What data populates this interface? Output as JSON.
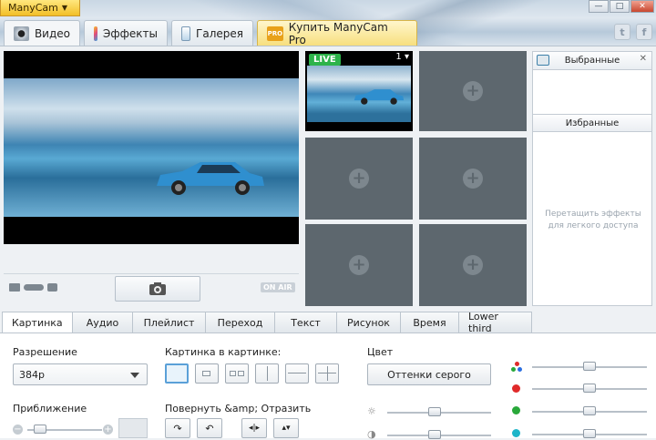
{
  "app": {
    "menu_label": "ManyCam"
  },
  "window": {
    "minimize": "—",
    "maximize": "□",
    "close": "✕"
  },
  "main_tabs": [
    {
      "label": "Видео",
      "icon": "webcam-icon"
    },
    {
      "label": "Эффекты",
      "icon": "effects-icon"
    },
    {
      "label": "Галерея",
      "icon": "gallery-icon"
    },
    {
      "label": "Купить ManyCam Pro",
      "icon": "pro-icon",
      "badge": "PRO"
    }
  ],
  "social": {
    "twitter": "t",
    "facebook": "f"
  },
  "preview": {
    "on_air": "ON AIR"
  },
  "sources": {
    "live_badge": "LIVE",
    "live_number": "1"
  },
  "favorites": {
    "header": "Выбранные",
    "favorites_title": "Избранные",
    "hint": "Перетащить эффекты для легкого доступа"
  },
  "bottom_tabs": [
    "Картинка",
    "Аудио",
    "Плейлист",
    "Переход",
    "Текст",
    "Рисунок",
    "Время",
    "Lower third"
  ],
  "panel": {
    "resolution_label": "Разрешение",
    "resolution_value": "384p",
    "zoom_label": "Приближение",
    "pip_label": "Картинка в картинке:",
    "rotate_label": "Повернуть &amp; Отразить",
    "color_label": "Цвет",
    "grayscale_button": "Оттенки серого"
  },
  "sliders": {
    "zoom": 0.1,
    "rgb": 0.5,
    "red": 0.5,
    "green": 0.5,
    "blue": 0.5,
    "brightness": 0.45,
    "contrast": 0.45
  },
  "colors": {
    "live_green": "#2db34a",
    "accent_blue": "#5aa0d8",
    "red_dot": "#e02a2a",
    "green_dot": "#29a83a",
    "cyan_dot": "#1eb5c9"
  }
}
